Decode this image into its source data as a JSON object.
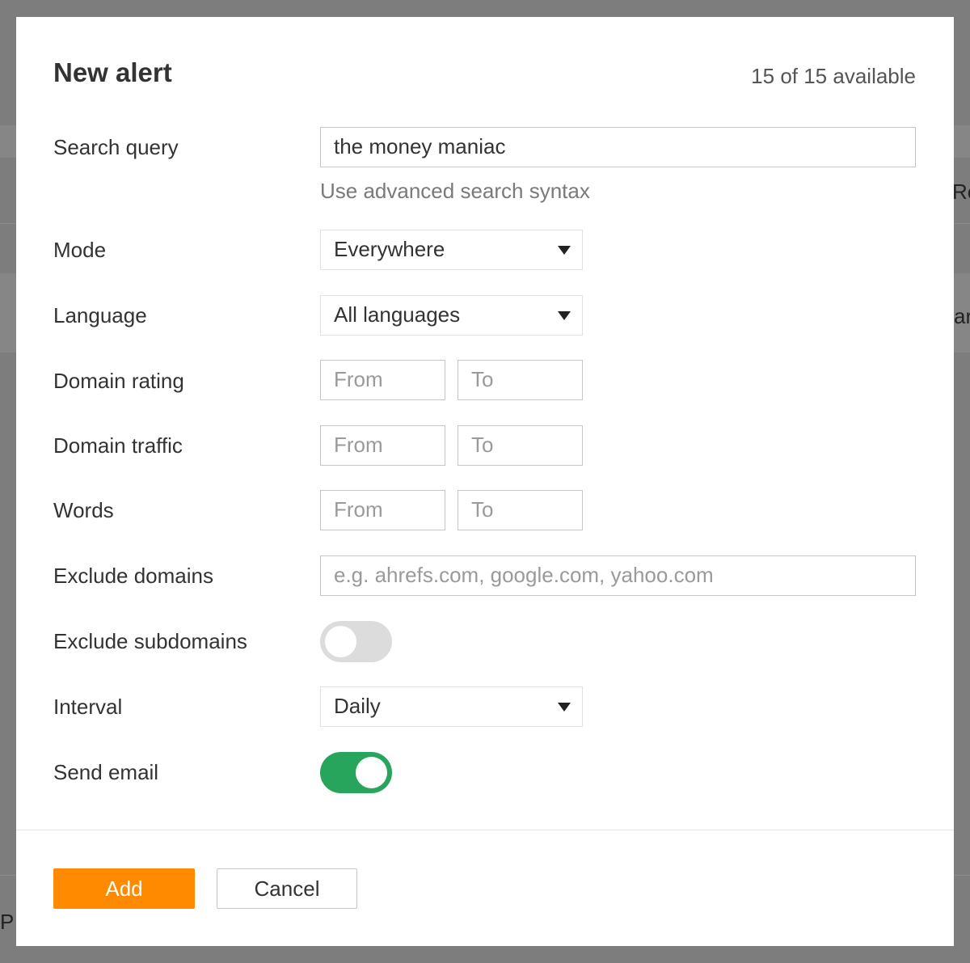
{
  "dialog": {
    "title": "New alert",
    "availability": "15 of 15 available"
  },
  "fields": {
    "search_query": {
      "label": "Search query",
      "value": "the money maniac",
      "hint": "Use advanced search syntax"
    },
    "mode": {
      "label": "Mode",
      "value": "Everywhere"
    },
    "language": {
      "label": "Language",
      "value": "All languages"
    },
    "domain_rating": {
      "label": "Domain rating",
      "from_placeholder": "From",
      "to_placeholder": "To"
    },
    "domain_traffic": {
      "label": "Domain traffic",
      "from_placeholder": "From",
      "to_placeholder": "To"
    },
    "words": {
      "label": "Words",
      "from_placeholder": "From",
      "to_placeholder": "To"
    },
    "exclude_domains": {
      "label": "Exclude domains",
      "placeholder": "e.g. ahrefs.com, google.com, yahoo.com"
    },
    "exclude_subdomains": {
      "label": "Exclude subdomains",
      "enabled": false
    },
    "interval": {
      "label": "Interval",
      "value": "Daily"
    },
    "send_email": {
      "label": "Send email",
      "enabled": true
    }
  },
  "buttons": {
    "add": "Add",
    "cancel": "Cancel"
  },
  "background_fragments": {
    "right_top": "Re",
    "right_mid": "ar",
    "left_bottom": "P"
  },
  "colors": {
    "accent_orange": "#ff8a00",
    "toggle_on_green": "#27a55d",
    "toggle_off_gray": "#dcdcdc",
    "overlay_gray": "#7d7d7d"
  }
}
